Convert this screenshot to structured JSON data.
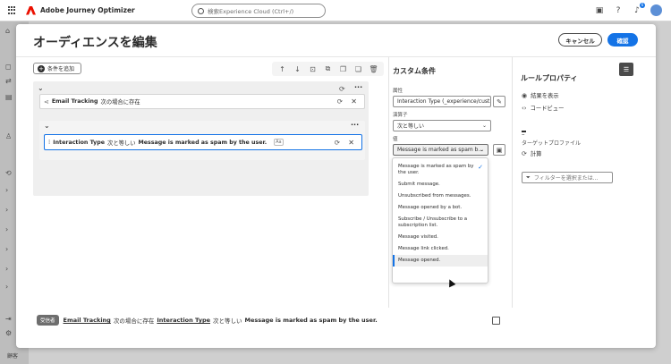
{
  "app": {
    "title": "Adobe Journey Optimizer"
  },
  "search": {
    "placeholder": "検索Experience Cloud (Ctrl+/)"
  },
  "header_icons": {
    "notification_count": "6"
  },
  "rail": {
    "bottom_label": "顧客"
  },
  "modal": {
    "title": "オーディエンスを編集",
    "cancel_label": "キャンセル",
    "confirm_label": "確認"
  },
  "canvas": {
    "add_condition_label": "条件を追加",
    "outer_row": {
      "event": "Email Tracking",
      "operator": "次の場合に存在"
    },
    "inner_row": {
      "field": "Interaction Type",
      "operator": "次と等しい",
      "value": "Message is marked as spam by the user.",
      "aa": "Aa"
    }
  },
  "summary": {
    "badge": "受信者",
    "event": "Email Tracking",
    "exists": "次の場合に存在",
    "field": "Interaction Type",
    "equals": "次と等しい",
    "value": "Message is marked as spam by the user."
  },
  "custom_condition": {
    "title": "カスタム条件",
    "attribute_label": "属性",
    "attribute_value": "Interaction Type (_experience/cust...",
    "operator_label": "演算子",
    "operator_value": "次と等しい",
    "value_label": "値",
    "value_value": "Message is marked as spam b..."
  },
  "dropdown": {
    "options": [
      "Message is marked as spam by the user.",
      "Submit message.",
      "Unsubscribed from messages.",
      "Message opened by a bot.",
      "Subscribe / Unsubscribe to a subscription list.",
      "Message visited.",
      "Message link clicked.",
      "Message opened."
    ],
    "selected_index": 0,
    "hovered_index": 7
  },
  "rule_properties": {
    "title": "ルールプロパティ",
    "show_results": "結果を表示",
    "code_view": "コードビュー",
    "dash": "–",
    "target_profile_label": "ターゲットプロファイル",
    "calculate": "計算",
    "filter_placeholder": "フィルターを選択または..."
  },
  "colors": {
    "accent": "#1473e6",
    "brand": "#eb1000"
  }
}
